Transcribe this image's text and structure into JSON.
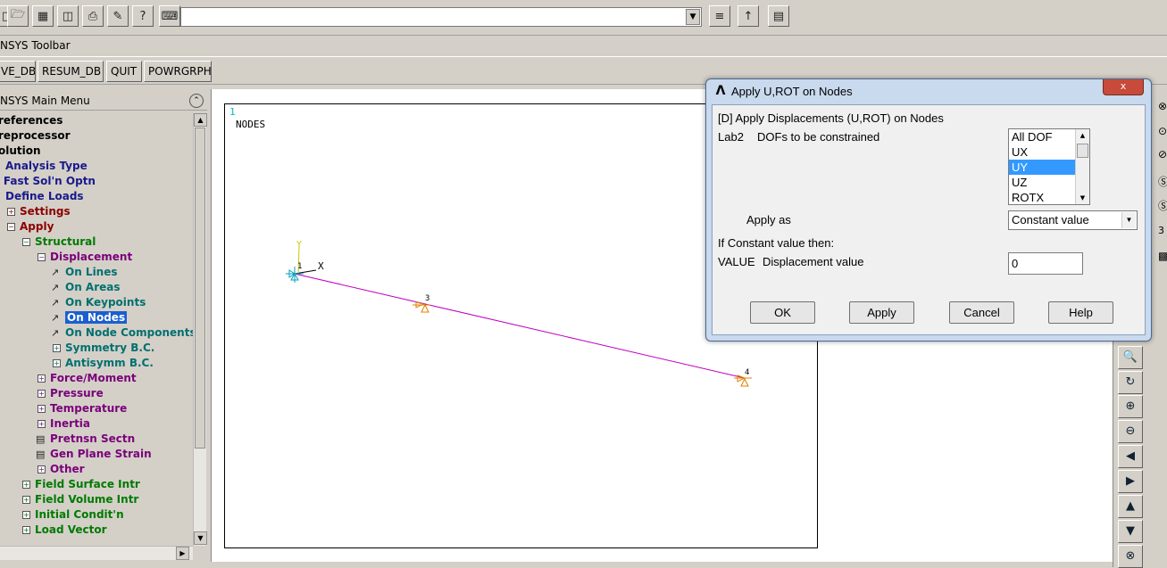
{
  "toolbar": {
    "command_input": "",
    "title": "NSYS Toolbar",
    "buttons": [
      "VE_DB",
      "RESUM_DB",
      "QUIT",
      "POWRGRPH"
    ]
  },
  "main_menu": {
    "title": "NSYS Main Menu",
    "items": [
      {
        "label": "references",
        "expand": "",
        "color": "#000000"
      },
      {
        "label": "reprocessor",
        "expand": "",
        "color": "#000000"
      },
      {
        "label": "olution",
        "expand": "",
        "color": "#000000"
      },
      {
        "label": "Analysis Type",
        "expand": "",
        "color": "#1a1a8c"
      },
      {
        "label": "Fast Sol'n Optn",
        "expand": "",
        "color": "#1a1a8c"
      },
      {
        "label": "Define Loads",
        "expand": "",
        "color": "#1a1a8c"
      },
      {
        "label": "Settings",
        "expand": "+",
        "color": "#8b0000"
      },
      {
        "label": "Apply",
        "expand": "-",
        "color": "#8b0000"
      },
      {
        "label": "Structural",
        "expand": "-",
        "color": "#007a00"
      },
      {
        "label": "Displacement",
        "expand": "-",
        "color": "#7a007a"
      },
      {
        "label": "On Lines",
        "expand": "",
        "color": "#007070"
      },
      {
        "label": "On Areas",
        "expand": "",
        "color": "#007070"
      },
      {
        "label": "On Keypoints",
        "expand": "",
        "color": "#007070"
      },
      {
        "label": "On Nodes",
        "expand": "",
        "color": "#007070"
      },
      {
        "label": "On Node Components",
        "expand": "",
        "color": "#007070"
      },
      {
        "label": "Symmetry B.C.",
        "expand": "+",
        "color": "#007070"
      },
      {
        "label": "Antisymm B.C.",
        "expand": "+",
        "color": "#007070"
      },
      {
        "label": "Force/Moment",
        "expand": "+",
        "color": "#7a007a"
      },
      {
        "label": "Pressure",
        "expand": "+",
        "color": "#7a007a"
      },
      {
        "label": "Temperature",
        "expand": "+",
        "color": "#7a007a"
      },
      {
        "label": "Inertia",
        "expand": "+",
        "color": "#7a007a"
      },
      {
        "label": "Pretnsn Sectn",
        "expand": "",
        "color": "#7a007a"
      },
      {
        "label": "Gen Plane Strain",
        "expand": "",
        "color": "#7a007a"
      },
      {
        "label": "Other",
        "expand": "+",
        "color": "#7a007a"
      },
      {
        "label": "Field Surface Intr",
        "expand": "+",
        "color": "#007a00"
      },
      {
        "label": "Field Volume Intr",
        "expand": "+",
        "color": "#007a00"
      },
      {
        "label": "Initial Condit'n",
        "expand": "+",
        "color": "#007a00"
      },
      {
        "label": "Load Vector",
        "expand": "+",
        "color": "#007a00"
      }
    ],
    "selected": "On Nodes"
  },
  "graphics": {
    "window_number": "1",
    "title": "NODES",
    "axis_x": "X",
    "axis_y": "Y",
    "node_labels": [
      "1",
      "3",
      "4"
    ]
  },
  "right_toolbar": {
    "side_value": "3"
  },
  "dialog": {
    "title": "Apply U,ROT on Nodes",
    "header": "[D]  Apply Displacements (U,ROT) on Nodes",
    "lab2_key": "Lab2",
    "lab2_desc": "DOFs to be constrained",
    "dof_options": [
      "All DOF",
      "UX",
      "UY",
      "UZ",
      "ROTX"
    ],
    "dof_selected": "UY",
    "apply_as_label": "Apply as",
    "apply_as_value": "Constant value",
    "if_const_label": "If Constant value then:",
    "value_key": "VALUE",
    "value_desc": "Displacement value",
    "value": "0",
    "buttons": {
      "ok": "OK",
      "apply": "Apply",
      "cancel": "Cancel",
      "help": "Help"
    },
    "close_label": "x"
  }
}
